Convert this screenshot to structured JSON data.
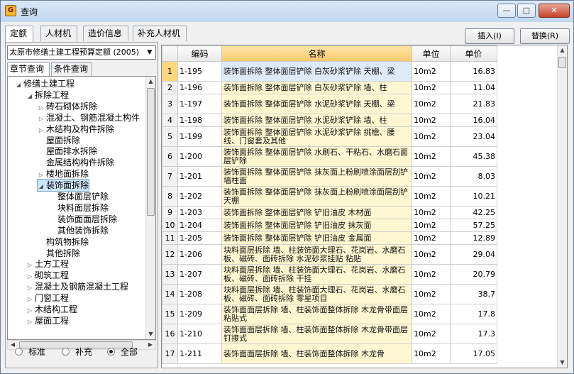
{
  "window": {
    "title": "查询",
    "app_icon": "app-logo-icon",
    "controls": {
      "minimize": "—",
      "maximize": "□",
      "close": "✕"
    }
  },
  "top_tabs": [
    "定额",
    "人材机",
    "造价信息",
    "补充人材机"
  ],
  "actions": {
    "insert": "插入(I)",
    "replace": "替换(R)"
  },
  "left": {
    "quota_select": "太原市修缮土建工程预算定额 (2005)",
    "subtabs": [
      "章节查询",
      "条件查询"
    ],
    "tree": [
      {
        "label": "修缮土建工程",
        "level": 0,
        "toggle": "◢"
      },
      {
        "label": "拆除工程",
        "level": 1,
        "toggle": "◢"
      },
      {
        "label": "砖石砌体拆除",
        "level": 2,
        "toggle": "▷"
      },
      {
        "label": "混凝土、钢筋混凝土构件",
        "level": 2,
        "toggle": "▷"
      },
      {
        "label": "木结构及构件拆除",
        "level": 2,
        "toggle": "▷"
      },
      {
        "label": "屋面拆除",
        "level": 2,
        "toggle": ""
      },
      {
        "label": "屋面排水拆除",
        "level": 2,
        "toggle": ""
      },
      {
        "label": "金属结构构件拆除",
        "level": 2,
        "toggle": ""
      },
      {
        "label": "楼地面拆除",
        "level": 2,
        "toggle": "▷"
      },
      {
        "label": "装饰面拆除",
        "level": 2,
        "toggle": "◢",
        "selected": true
      },
      {
        "label": "整体面层铲除",
        "level": 3,
        "toggle": ""
      },
      {
        "label": "块料面层拆除",
        "level": 3,
        "toggle": ""
      },
      {
        "label": "装饰面面层拆除",
        "level": 3,
        "toggle": ""
      },
      {
        "label": "其他装饰拆除",
        "level": 3,
        "toggle": ""
      },
      {
        "label": "构筑物拆除",
        "level": 2,
        "toggle": ""
      },
      {
        "label": "其他拆除",
        "level": 2,
        "toggle": ""
      },
      {
        "label": "土方工程",
        "level": 1,
        "toggle": "▷"
      },
      {
        "label": "砌筑工程",
        "level": 1,
        "toggle": "▷"
      },
      {
        "label": "混凝土及钢筋混凝土工程",
        "level": 1,
        "toggle": "▷"
      },
      {
        "label": "门窗工程",
        "level": 1,
        "toggle": "▷"
      },
      {
        "label": "木结构工程",
        "level": 1,
        "toggle": "▷"
      },
      {
        "label": "屋面工程",
        "level": 1,
        "toggle": "▷"
      }
    ],
    "radios": [
      {
        "label": "标准",
        "checked": false
      },
      {
        "label": "补充",
        "checked": false
      },
      {
        "label": "全部",
        "checked": true
      }
    ]
  },
  "grid": {
    "columns": [
      "",
      "编码",
      "名称",
      "单位",
      "单价"
    ],
    "rows": [
      {
        "n": "1",
        "code": "1-195",
        "name": "装饰面拆除 整体面层铲除 白灰砂浆铲除 天棚、梁",
        "unit": "10m2",
        "price": "16.83",
        "selected": true
      },
      {
        "n": "2",
        "code": "1-196",
        "name": "装饰面拆除 整体面层铲除 白灰砂浆铲除 墙、柱",
        "unit": "10m2",
        "price": "11.04"
      },
      {
        "n": "3",
        "code": "1-197",
        "name": "装饰面拆除 整体面层铲除 水泥砂浆铲除 天棚、梁",
        "unit": "10m2",
        "price": "21.83"
      },
      {
        "n": "4",
        "code": "1-198",
        "name": "装饰面拆除 整体面层铲除 水泥砂浆铲除 墙、柱",
        "unit": "10m2",
        "price": "16.04"
      },
      {
        "n": "5",
        "code": "1-199",
        "name": "装饰面拆除 整体面层铲除 水泥砂浆铲除 挑檐、腰线、门窗套及其他",
        "unit": "10m2",
        "price": "23.04"
      },
      {
        "n": "6",
        "code": "1-200",
        "name": "装饰面拆除 整体面层铲除 水刷石、干粘石、水磨石面层铲除",
        "unit": "10m2",
        "price": "45.38"
      },
      {
        "n": "7",
        "code": "1-201",
        "name": "装饰面拆除 整体面层铲除 抹灰面上粉刷喷涂面层刮铲 墙柱面",
        "unit": "10m2",
        "price": "8.03"
      },
      {
        "n": "8",
        "code": "1-202",
        "name": "装饰面拆除 整体面层铲除 抹灰面上粉刷喷涂面层刮铲 天棚",
        "unit": "10m2",
        "price": "10.21"
      },
      {
        "n": "9",
        "code": "1-203",
        "name": "装饰面拆除 整体面层铲除 铲旧油皮 木材面",
        "unit": "10m2",
        "price": "42.25"
      },
      {
        "n": "10",
        "code": "1-204",
        "name": "装饰面拆除 整体面层铲除 铲旧油皮 抹灰面",
        "unit": "10m2",
        "price": "57.25"
      },
      {
        "n": "11",
        "code": "1-205",
        "name": "装饰面拆除 整体面层铲除 铲旧油皮 金属面",
        "unit": "10m2",
        "price": "12.89"
      },
      {
        "n": "12",
        "code": "1-206",
        "name": "块料面层拆除 墙、柱装饰面大理石、花岗岩、水磨石板、磁砖、面砖拆除 水泥砂浆挂贴 粘贴",
        "unit": "10m2",
        "price": "29.04"
      },
      {
        "n": "13",
        "code": "1-207",
        "name": "块料面层拆除 墙、柱装饰面大理石、花岗岩、水磨石板、磁砖、面砖拆除 干挂",
        "unit": "10m2",
        "price": "20.79"
      },
      {
        "n": "14",
        "code": "1-208",
        "name": "块料面层拆除 墙、柱装饰面大理石、花岗岩、水磨石板、磁砖、面砖拆除 零星项目",
        "unit": "10m2",
        "price": "38.7"
      },
      {
        "n": "15",
        "code": "1-209",
        "name": "装饰面面层拆除 墙、柱装饰面整体拆除 木龙骨带面层 粘贴式",
        "unit": "10m2",
        "price": "17.8"
      },
      {
        "n": "16",
        "code": "1-210",
        "name": "装饰面面层拆除 墙、柱装饰面整体拆除 木龙骨带面层 钉接式",
        "unit": "10m2",
        "price": "17.3"
      },
      {
        "n": "17",
        "code": "1-211",
        "name": "装饰面面层拆除 墙、柱装饰面整体拆除 木龙骨",
        "unit": "10m2",
        "price": "17.05"
      }
    ]
  }
}
